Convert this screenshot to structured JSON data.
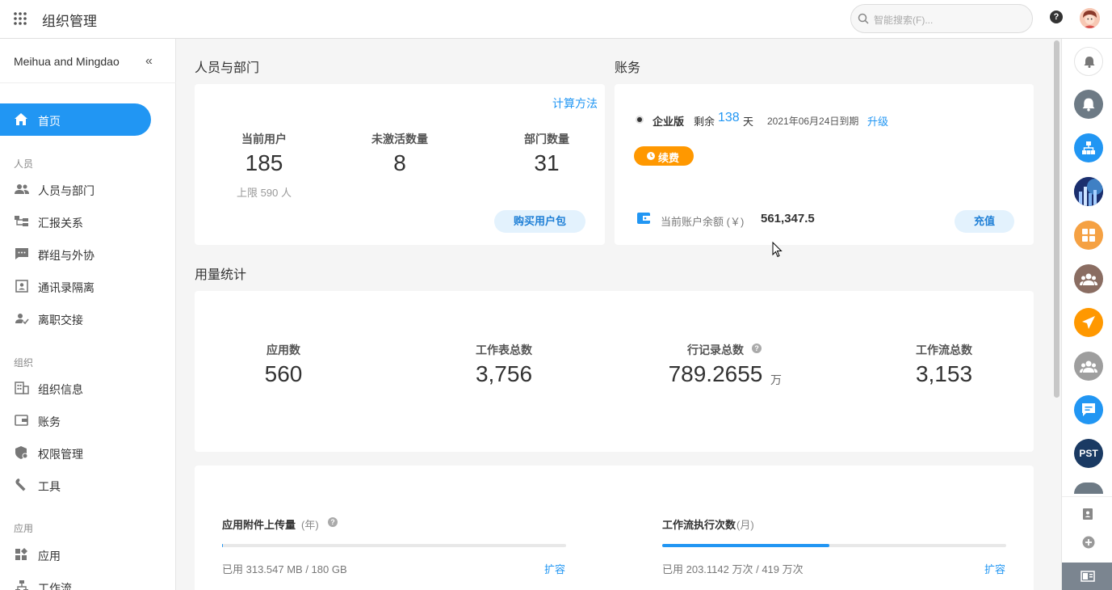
{
  "topbar": {
    "title": "组织管理",
    "search_placeholder": "智能搜索(F)...",
    "help": "?"
  },
  "sidebar": {
    "org_name": "Meihua and Mingdao",
    "collapse": "«",
    "home": "首页",
    "sections": {
      "people": "人员",
      "org": "组织",
      "apps": "应用"
    },
    "people_items": [
      "人员与部门",
      "汇报关系",
      "群组与外协",
      "通讯录隔离",
      "离职交接"
    ],
    "org_items": [
      "组织信息",
      "账务",
      "权限管理",
      "工具"
    ],
    "app_items": [
      "应用",
      "工作流"
    ]
  },
  "people_dept": {
    "title": "人员与部门",
    "calc_link": "计算方法",
    "current_users_label": "当前用户",
    "current_users": "185",
    "limit": "上限 590 人",
    "inactive_label": "未激活数量",
    "inactive": "8",
    "dept_label": "部门数量",
    "dept": "31",
    "buy_button": "购买用户包"
  },
  "billing": {
    "title": "账务",
    "edition": "企业版",
    "remain_prefix": "剩余",
    "remain_days": "138",
    "remain_suffix": "天",
    "expire": "2021年06月24日到期",
    "upgrade": "升级",
    "renew": "续费",
    "balance_label": "当前账户余额 (￥)",
    "balance": "561,347.5",
    "recharge": "充值"
  },
  "usage": {
    "title": "用量统计",
    "apps_label": "应用数",
    "apps": "560",
    "sheets_label": "工作表总数",
    "sheets": "3,756",
    "rows_label": "行记录总数",
    "rows": "789.2655",
    "rows_unit": "万",
    "flows_label": "工作流总数",
    "flows": "3,153"
  },
  "quota": {
    "attach_label": "应用附件上传量",
    "attach_period": "(年)",
    "attach_used": "已用 313.547 MB / 180 GB",
    "attach_fraction": 0.002,
    "attach_expand": "扩容",
    "flow_label": "工作流执行次数",
    "flow_period": "(月)",
    "flow_used": "已用 203.1142 万次 / 419 万次",
    "flow_fraction": 0.485,
    "flow_expand": "扩容"
  },
  "rightbar": {
    "pst": "PST"
  },
  "colors": {
    "accent": "#2196f3",
    "renew": "#ff9800"
  }
}
